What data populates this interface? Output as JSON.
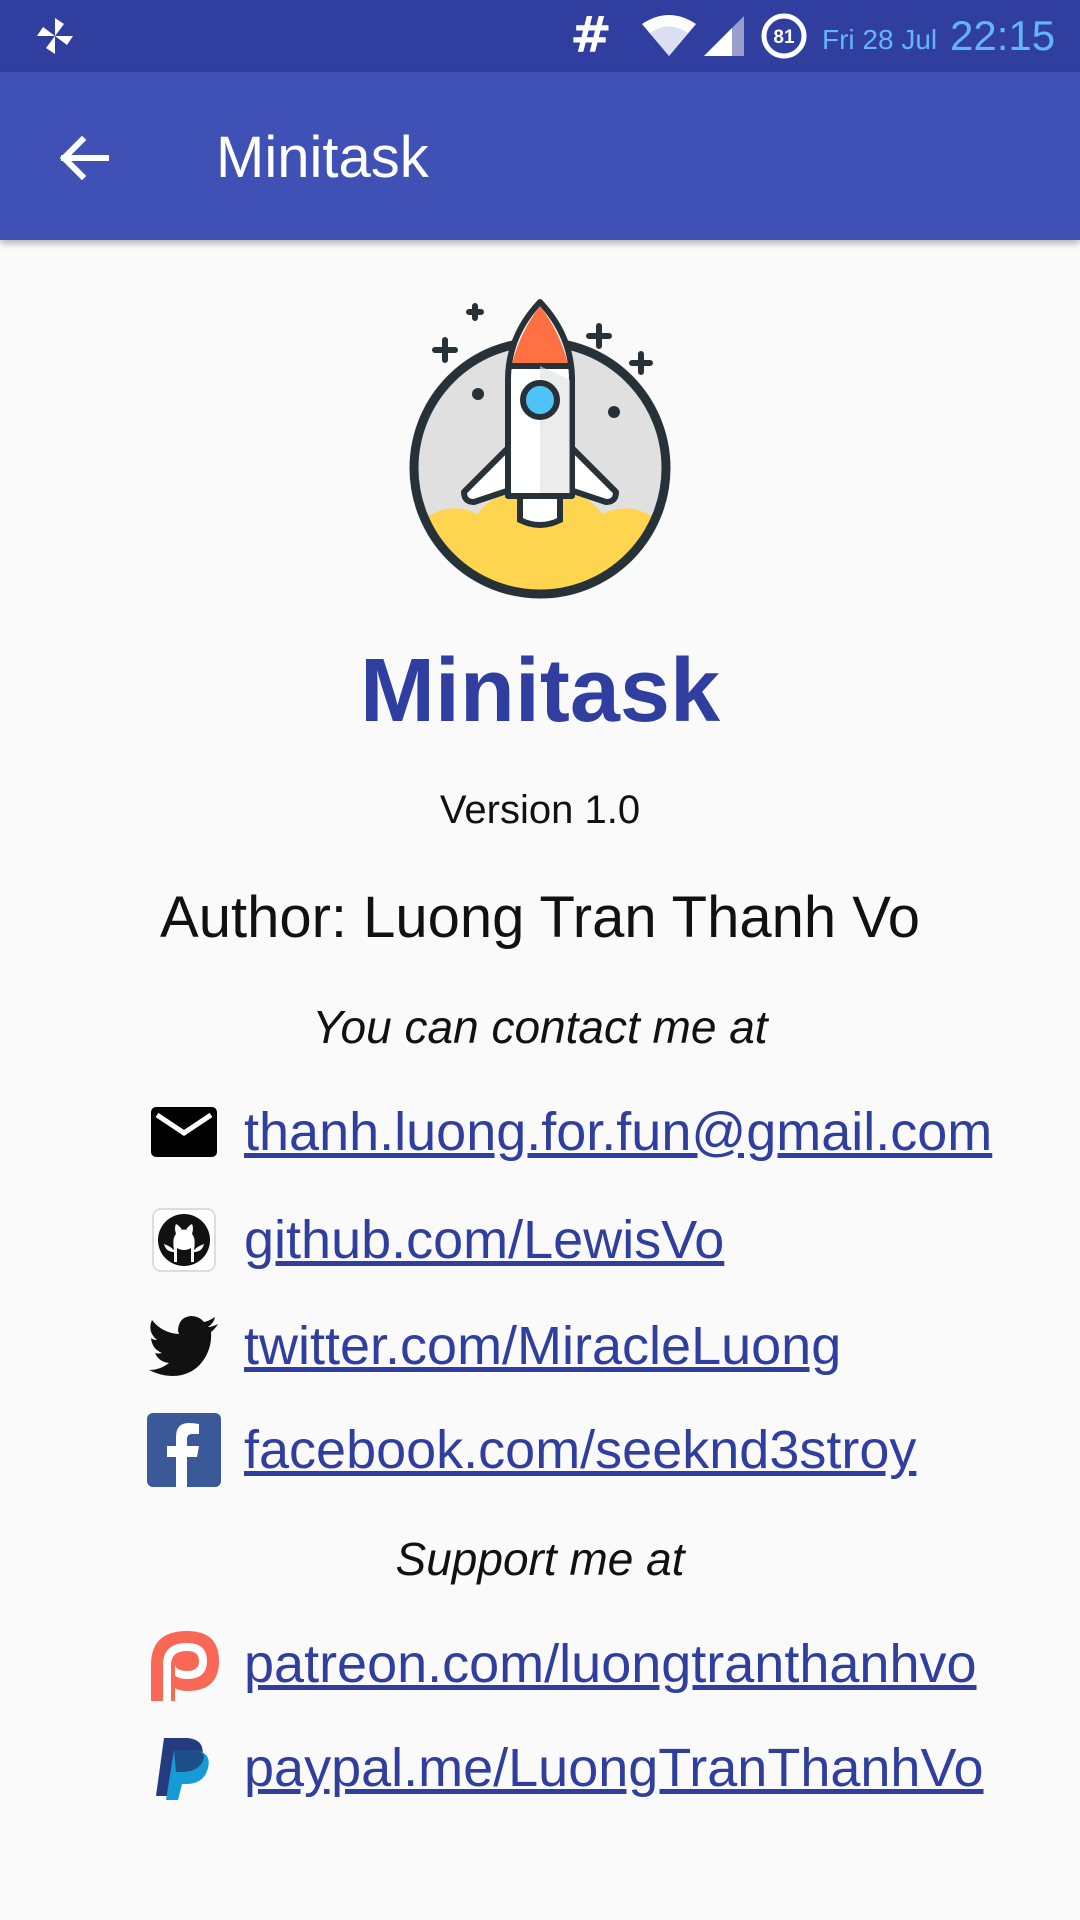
{
  "status_bar": {
    "hash_symbol": "#",
    "battery_level": "81",
    "date": "Fri 28 Jul",
    "time": "22:15"
  },
  "app_bar": {
    "title": "Minitask",
    "back_icon": "arrow-back-icon"
  },
  "about": {
    "app_name": "Minitask",
    "version": "Version 1.0",
    "author": "Author: Luong Tran Thanh Vo",
    "contact_heading": "You can contact me at",
    "support_heading": "Support me at"
  },
  "contacts": [
    {
      "icon": "email-icon",
      "text": "thanh.luong.for.fun@gmail.com"
    },
    {
      "icon": "github-icon",
      "text": "github.com/LewisVo"
    },
    {
      "icon": "twitter-icon",
      "text": "twitter.com/MiracleLuong"
    },
    {
      "icon": "facebook-icon",
      "text": "facebook.com/seeknd3stroy"
    }
  ],
  "support": [
    {
      "icon": "patreon-icon",
      "text": "patreon.com/luongtranthanhvo"
    },
    {
      "icon": "paypal-icon",
      "text": "paypal.me/LuongTranThanhVo"
    }
  ],
  "colors": {
    "status_bar": "#303f9f",
    "app_bar": "#3f51b5",
    "accent_text": "#303f9f",
    "clock": "#64b5f6"
  }
}
